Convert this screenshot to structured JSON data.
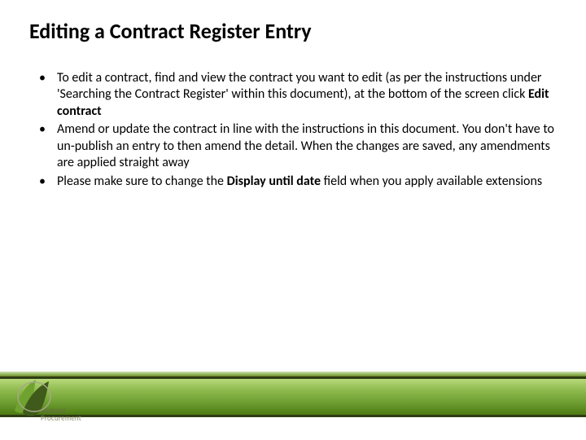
{
  "title": "Editing a Contract Register Entry",
  "bullets": [
    {
      "pre": "To edit a contract, find and view the contract you want to edit (as per the instructions under 'Searching the Contract Register' within this document), at the bottom of the screen click ",
      "bold": "Edit contract",
      "post": ""
    },
    {
      "pre": "Amend or update the contract in line with the instructions in this document. You don't have to un-publish an entry to then amend the detail. When the changes are saved, any amendments are applied straight away",
      "bold": "",
      "post": ""
    },
    {
      "pre": "Please make sure to change the ",
      "bold": "Display until date",
      "post": " field when you apply available extensions"
    }
  ],
  "logo": {
    "brand": "Welland",
    "sub": "Procurement"
  },
  "colors": {
    "accent_green": "#6a9a2f",
    "dark_band": "#2f3b14"
  }
}
